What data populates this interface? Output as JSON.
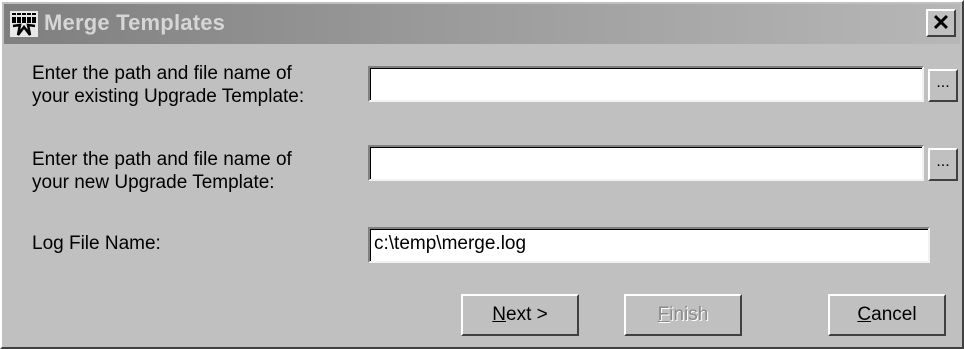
{
  "window": {
    "title": "Merge Templates",
    "close_label": "✕"
  },
  "form": {
    "existing_template": {
      "label": "Enter the path and file name of\nyour existing Upgrade Template:",
      "value": "",
      "browse_label": "..."
    },
    "new_template": {
      "label": "Enter the path and file name of\nyour new Upgrade Template:",
      "value": "",
      "browse_label": "..."
    },
    "log_file": {
      "label": "Log File Name:",
      "value": "c:\\temp\\merge.log"
    }
  },
  "buttons": {
    "next": {
      "mnemonic": "N",
      "rest": "ext >"
    },
    "finish": {
      "mnemonic": "F",
      "rest": "inish",
      "enabled": false
    },
    "cancel": {
      "mnemonic": "C",
      "rest": "ancel"
    }
  },
  "icons": {
    "app": "app-logo-icon",
    "close": "close-icon"
  },
  "colors": {
    "face": "#c0c0c0",
    "titlebar_inactive": "#808080",
    "disabled_text": "#8a8a8a"
  }
}
